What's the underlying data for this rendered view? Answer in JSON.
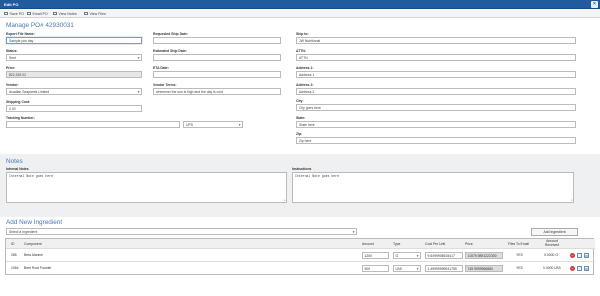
{
  "window": {
    "title": "Edit PO",
    "close_label": "×"
  },
  "toolbar": [
    {
      "label": "Save PO",
      "icon": "save-icon"
    },
    {
      "label": "Email PO",
      "icon": "email-icon"
    },
    {
      "label": "View Notes",
      "icon": "notes-icon"
    },
    {
      "label": "View Files",
      "icon": "files-icon"
    }
  ],
  "form": {
    "heading": "Manage PO# 42930031",
    "export_file_name": {
      "label": "Export File Name:",
      "value": "Sample pos day"
    },
    "status": {
      "label": "Status:",
      "value": "Sent"
    },
    "price": {
      "label": "Price:",
      "value": "$22,329.02"
    },
    "vendor": {
      "label": "Vendor:",
      "value": "Acadian Seaplants Limited"
    },
    "shipping_cost": {
      "label": "Shipping Cost:",
      "value": "0.00"
    },
    "tracking_number": {
      "label": "Tracking Number:",
      "value": "",
      "carrier": "UPS"
    },
    "requested_ship_date": {
      "label": "Requested Ship Date:",
      "value": ""
    },
    "estimated_ship_date": {
      "label": "Estimated Ship Date:",
      "value": ""
    },
    "eta_date": {
      "label": "ETA Date:",
      "value": ""
    },
    "vendor_terms": {
      "label": "Vendor Terms:",
      "value": "whenever the sun is high and the day is cold"
    },
    "ship_to": {
      "label": "Ship to:",
      "value": "JW Nutritional"
    },
    "attn": {
      "label": "ATTN:",
      "value": "ATTN"
    },
    "address1": {
      "label": "Address 1:",
      "value": "Address 1"
    },
    "address2": {
      "label": "Address 2:",
      "value": "Address 2"
    },
    "city": {
      "label": "City:",
      "value": "City goes here"
    },
    "state": {
      "label": "State:",
      "value": "State here"
    },
    "zip": {
      "label": "Zip:",
      "value": "Zip here"
    }
  },
  "notes": {
    "heading": "Notes",
    "internal": {
      "label": "Internal Notes",
      "value": "Internal Note goes here"
    },
    "instructions": {
      "label": "Instructions",
      "value": "Internal Note goes here"
    }
  },
  "ingredients": {
    "heading": "Add New Ingredient",
    "select_placeholder": "Select a Ingredient",
    "add_button": "Add Ingredient",
    "columns": [
      "ID",
      "Component",
      "Amount",
      "Type",
      "Cost Per Unit",
      "Price",
      "Files To Email",
      "Amount Received"
    ],
    "rows": [
      {
        "id": "285",
        "component": "Beta Alanine",
        "amount": "1200",
        "type": "G",
        "cost_per_unit": "9.6499906515417",
        "price": "11579.9891222300",
        "files_to_email": "YES",
        "amount_received": "0.0000 G"
      },
      {
        "id": "1064",
        "component": "Beet Root Powder",
        "amount": "500",
        "type": "LBS",
        "cost_per_unit": "1.49999999931759",
        "price": "749.9999965880",
        "files_to_email": "YES",
        "amount_received": "0.0000 LBS"
      }
    ]
  }
}
